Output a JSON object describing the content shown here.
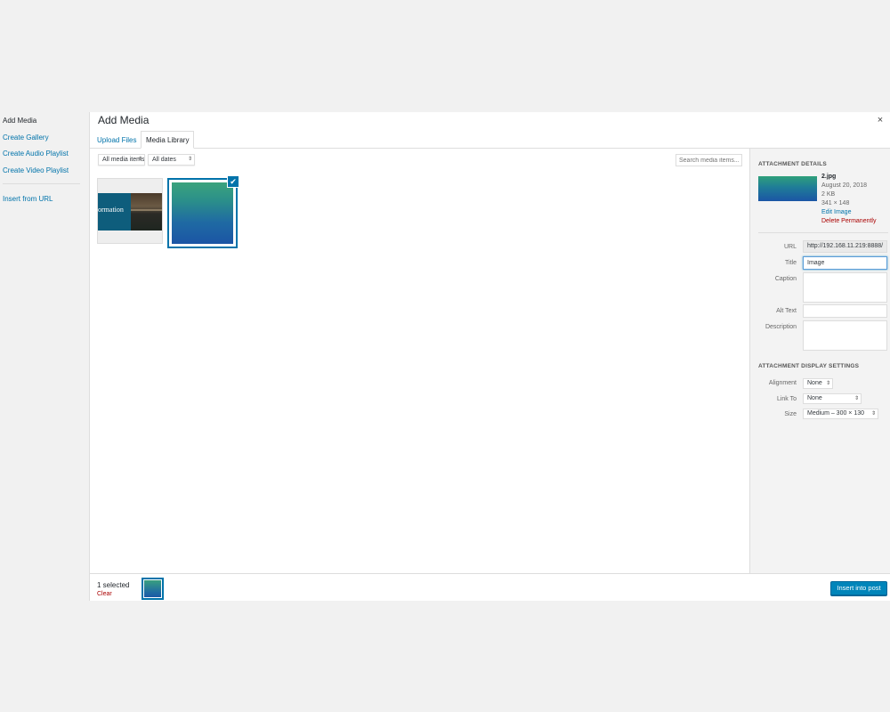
{
  "menu": {
    "items": [
      {
        "label": "Add Media"
      },
      {
        "label": "Create Gallery"
      },
      {
        "label": "Create Audio Playlist"
      },
      {
        "label": "Create Video Playlist"
      },
      {
        "label": "Insert from URL"
      }
    ]
  },
  "modal": {
    "title": "Add Media",
    "close_icon": "×"
  },
  "tabs": [
    {
      "label": "Upload Files"
    },
    {
      "label": "Media Library"
    }
  ],
  "toolbar": {
    "type_filter": "All media items",
    "date_filter": "All dates",
    "search_placeholder": "Search media items..."
  },
  "grid": {
    "items": [
      {
        "caption_fragment": "ormation"
      },
      {
        "selected": true,
        "check_icon": "✔"
      }
    ]
  },
  "details": {
    "heading": "ATTACHMENT DETAILS",
    "filename": "2.jpg",
    "date": "August 20, 2018",
    "size": "2 KB",
    "dimensions": "341 × 148",
    "edit_link": "Edit Image",
    "delete_link": "Delete Permanently",
    "fields": {
      "url_label": "URL",
      "url_value": "http://192.168.11.219:8888/",
      "title_label": "Title",
      "title_value": "Image",
      "caption_label": "Caption",
      "alt_label": "Alt Text",
      "description_label": "Description"
    }
  },
  "display_settings": {
    "heading": "ATTACHMENT DISPLAY SETTINGS",
    "alignment_label": "Alignment",
    "alignment_value": "None",
    "link_label": "Link To",
    "link_value": "None",
    "size_label": "Size",
    "size_value": "Medium – 300 × 130"
  },
  "footer": {
    "count": "1 selected",
    "clear": "Clear",
    "insert_button": "Insert into post"
  },
  "colors": {
    "accent": "#0073aa",
    "button": "#0085ba",
    "delete": "#aa0000"
  }
}
